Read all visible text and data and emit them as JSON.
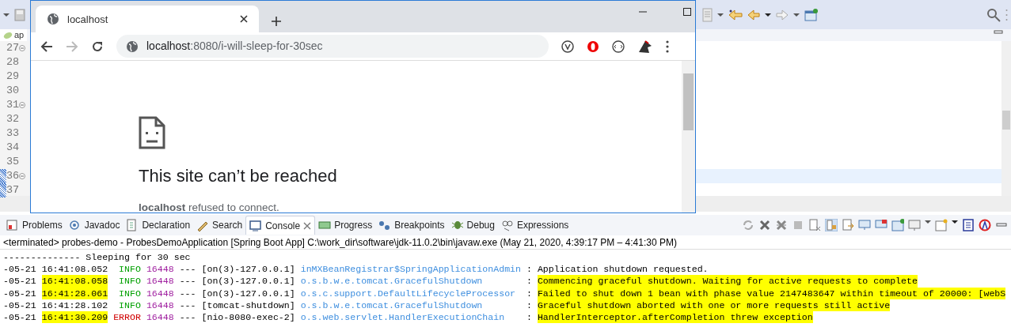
{
  "editor": {
    "tab_label": "ap",
    "lines": [
      {
        "number": "27",
        "foldable": true,
        "changed": false,
        "current": false
      },
      {
        "number": "28",
        "foldable": false,
        "changed": false,
        "current": false
      },
      {
        "number": "29",
        "foldable": false,
        "changed": false,
        "current": false
      },
      {
        "number": "30",
        "foldable": false,
        "changed": false,
        "current": false
      },
      {
        "number": "31",
        "foldable": true,
        "changed": false,
        "current": false
      },
      {
        "number": "32",
        "foldable": false,
        "changed": false,
        "current": false
      },
      {
        "number": "33",
        "foldable": false,
        "changed": false,
        "current": false
      },
      {
        "number": "34",
        "foldable": false,
        "changed": false,
        "current": false
      },
      {
        "number": "35",
        "foldable": false,
        "changed": false,
        "current": false
      },
      {
        "number": "36",
        "foldable": true,
        "changed": true,
        "current": true
      },
      {
        "number": "37",
        "foldable": false,
        "changed": true,
        "current": false
      }
    ]
  },
  "browser": {
    "tab_title": "localhost",
    "url_host": "localhost",
    "url_rest": ":8080/i-will-sleep-for-30sec",
    "error_title": "This site can’t be reached",
    "error_detail": "**localhost** refused to connect."
  },
  "panel": {
    "tabs": [
      {
        "label": "Problems",
        "selected": false
      },
      {
        "label": "Javadoc",
        "selected": false
      },
      {
        "label": "Declaration",
        "selected": false
      },
      {
        "label": "Search",
        "selected": false
      },
      {
        "label": "Console",
        "selected": true
      },
      {
        "label": "Progress",
        "selected": false
      },
      {
        "label": "Breakpoints",
        "selected": false
      },
      {
        "label": "Debug",
        "selected": false
      },
      {
        "label": "Expressions",
        "selected": false
      }
    ],
    "console_header": "<terminated> probes-demo - ProbesDemoApplication [Spring Boot App] C:\\work_dir\\software\\jdk-11.0.2\\bin\\javaw.exe  (May 21, 2020, 4:39:17 PM – 4:41:30 PM)",
    "console_lines": [
      {
        "kind": "plain",
        "text": "-------------- Sleeping for 30 sec"
      },
      {
        "kind": "log",
        "date": "-05-21",
        "time": "16:41:08.052",
        "time_highlighted": false,
        "level": "INFO",
        "color": "#00a000",
        "pid": "16448",
        "separator": "---",
        "thread": "[on(3)-127.0.0.1]",
        "logger": "inMXBeanRegistrar$SpringApplicationAdmin",
        "colon": ":",
        "message": "Application shutdown requested.",
        "message_highlighted": false
      },
      {
        "kind": "log",
        "date": "-05-21",
        "time": "16:41:08.058",
        "time_highlighted": true,
        "level": "INFO",
        "color": "#00a000",
        "pid": "16448",
        "separator": "---",
        "thread": "[on(3)-127.0.0.1]",
        "logger": "o.s.b.w.e.tomcat.GracefulShutdown",
        "colon": ":",
        "message": "Commencing graceful shutdown. Waiting for active requests to complete",
        "message_highlighted": true
      },
      {
        "kind": "log",
        "date": "-05-21",
        "time": "16:41:28.061",
        "time_highlighted": true,
        "level": "INFO",
        "color": "#00a000",
        "pid": "16448",
        "separator": "---",
        "thread": "[on(3)-127.0.0.1]",
        "logger": "o.s.c.support.DefaultLifecycleProcessor",
        "colon": ":",
        "message": "Failed to shut down 1 bean with phase value 2147483647 within timeout of 20000: [webS",
        "message_highlighted": true
      },
      {
        "kind": "log",
        "date": "-05-21",
        "time": "16:41:28.102",
        "time_highlighted": false,
        "level": "INFO",
        "color": "#00a000",
        "pid": "16448",
        "separator": "---",
        "thread": "[tomcat-shutdown]",
        "logger": "o.s.b.w.e.tomcat.GracefulShutdown",
        "colon": ":",
        "message": "Graceful shutdown aborted with one or more requests still active",
        "message_highlighted": true
      },
      {
        "kind": "log",
        "date": "-05-21",
        "time": "16:41:30.209",
        "time_highlighted": true,
        "level": "ERROR",
        "color": "#d00000",
        "pid": "16448",
        "separator": "---",
        "thread": "[nio-8080-exec-2]",
        "logger": "o.s.web.servlet.HandlerExecutionChain",
        "colon": ":",
        "message": "HandlerInterceptor.afterCompletion threw exception",
        "message_highlighted": true
      }
    ]
  }
}
